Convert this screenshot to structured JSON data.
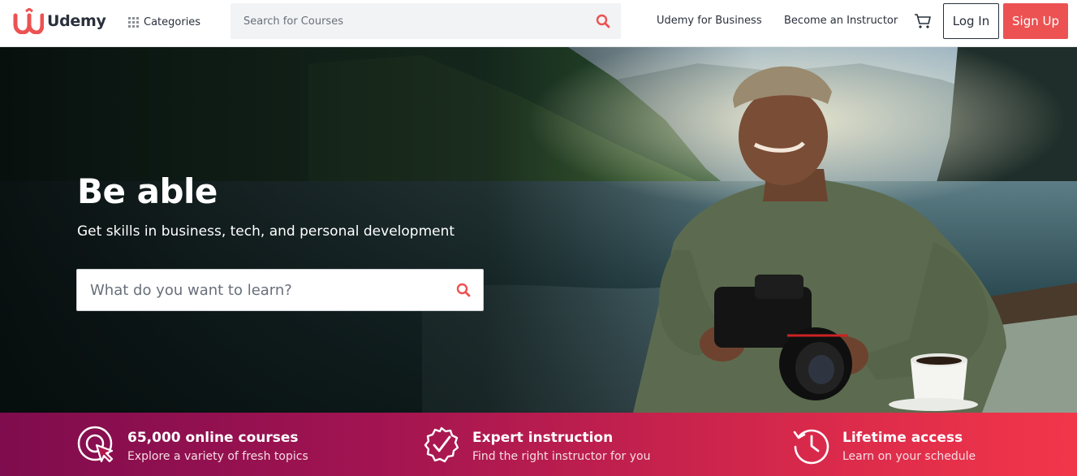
{
  "header": {
    "brand": "Udemy",
    "categories_label": "Categories",
    "search_placeholder": "Search for Courses",
    "business_link": "Udemy for Business",
    "instructor_link": "Become an Instructor",
    "login_label": "Log In",
    "signup_label": "Sign Up",
    "icons": [
      "udemy-logo-icon",
      "grid-icon",
      "search-icon",
      "cart-icon"
    ]
  },
  "hero": {
    "title": "Be able",
    "subtitle": "Get skills in business, tech, and personal development",
    "search_placeholder": "What do you want to learn?"
  },
  "features": [
    {
      "title": "65,000 online courses",
      "description": "Explore a variety of fresh topics",
      "icon": "target-cursor-icon"
    },
    {
      "title": "Expert instruction",
      "description": "Find the right instructor for you",
      "icon": "badge-check-icon"
    },
    {
      "title": "Lifetime access",
      "description": "Learn on your schedule",
      "icon": "clock-history-icon"
    }
  ],
  "colors": {
    "brand_red": "#ec5252",
    "text_dark": "#29303b",
    "feature_gradient_start": "#7f0c4e",
    "feature_gradient_end": "#f2364a"
  }
}
